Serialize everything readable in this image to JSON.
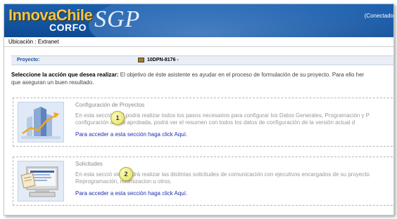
{
  "header": {
    "brand_title": "InnovaChile",
    "brand_sub": "CORFO",
    "app_logo": "SGP",
    "connection_status": "(Conectado"
  },
  "breadcrumb": "Ubicación : Extranet",
  "project": {
    "label": "Proyecto:",
    "icon": "briefcase-icon",
    "code": "10DPN-8176 -"
  },
  "intro": {
    "bold": "Seleccione la acción que desea realizar:",
    "text": " El objetivo de éste asistente es ayudar en el proceso de formulación de su proyecto. Para ello her",
    "line2": "que aseguran un buen resultado."
  },
  "sections": [
    {
      "title": "Configuración de Proyectos",
      "desc_line1": "En esta secció      sted podrá realizar todos los pasos necesarios para configurar los Datos Generales, Programación y P",
      "desc_line2": "configuración      a sido aprobada, podrá ver el resumen con todos los datos de configuración de la versión actual d",
      "link": "Para acceder a esta sección haga click Aquí.",
      "icon": "buildings-chart-icon",
      "callout": "1"
    },
    {
      "title": "Solicitudes",
      "desc_line1": "En esta secció      sted podrá realizar las distintas solicitudes de comunicación con ejecutivos encargados de su proyecto",
      "desc_line2": "Reprogramación, reitimizacion u otros.",
      "link": "Para acceder a esta sección haga click Aquí.",
      "icon": "computer-document-icon",
      "callout": "2"
    }
  ],
  "colors": {
    "header_blue": "#1a5fae",
    "brand_yellow": "#f4c542",
    "link_blue": "#1b2fb0",
    "project_bar": "#e9eef6"
  }
}
